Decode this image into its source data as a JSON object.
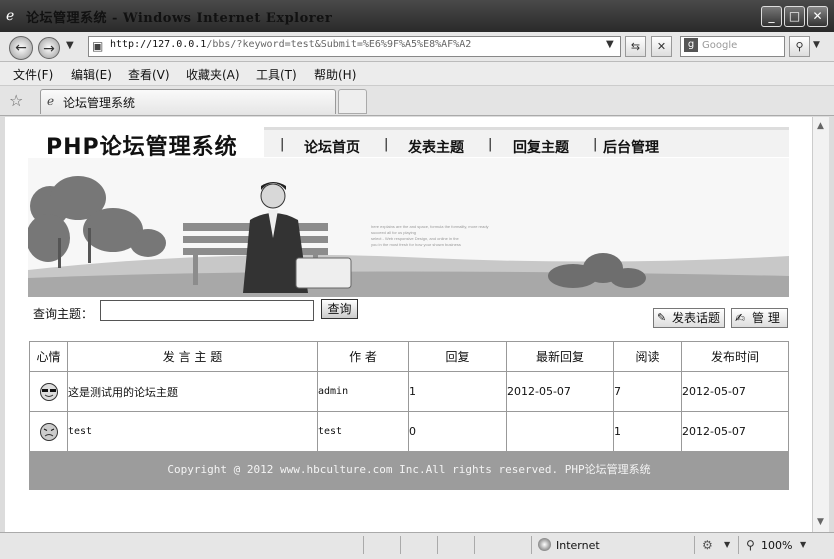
{
  "window": {
    "title": "论坛管理系统 - Windows Internet Explorer",
    "minimize": "_",
    "maximize": "□",
    "close": "✕"
  },
  "address": {
    "url_host": "http://127.0.0.1",
    "url_rest": "/bbs/?keyword=test&Submit=%E6%9F%A5%E8%AF%A2",
    "search_placeholder": "Google"
  },
  "menu": [
    "文件(F)",
    "编辑(E)",
    "查看(V)",
    "收藏夹(A)",
    "工具(T)",
    "帮助(H)"
  ],
  "tab": {
    "title": "论坛管理系统"
  },
  "site": {
    "logo": "PHP论坛管理系统",
    "nav": [
      "论坛首页",
      "发表主题",
      "回复主题",
      "后台管理"
    ],
    "search_label": "查询主题：",
    "search_button": "查询",
    "post_button": "发表话题",
    "manage_button": "管 理",
    "banner_text_lines": [
      "here explains are the and space, formula the formality, more ready",
      "succeed all for us playing",
      "select - Web responsive Design, and online in the",
      "you in the most fresh for how your shown business"
    ]
  },
  "table": {
    "headers": [
      "心情",
      "发 言 主 题",
      "作 者",
      "回复",
      "最新回复",
      "阅读",
      "发布时间"
    ],
    "rows": [
      {
        "mood": "cool-face",
        "subject": "这是测试用的论坛主题",
        "author": "admin",
        "replies": "1",
        "last_reply": "2012-05-07",
        "reads": "7",
        "published": "2012-05-07"
      },
      {
        "mood": "angry-face",
        "subject": "test",
        "author": "test",
        "replies": "0",
        "last_reply": "",
        "reads": "1",
        "published": "2012-05-07"
      }
    ]
  },
  "footer": "Copyright @ 2012 www.hbculture.com Inc.All rights reserved. PHP论坛管理系统",
  "status": {
    "zone": "Internet",
    "zoom": "100%"
  }
}
